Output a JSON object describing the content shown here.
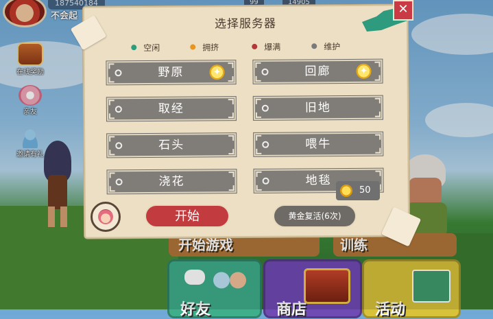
{
  "topbar": {
    "player_id": "187540184",
    "player_name": "不会起",
    "resource_1": "99",
    "resource_2": "14905"
  },
  "side_menu": {
    "items": [
      {
        "label": "在线奖励",
        "icon": "treasure-chest-icon"
      },
      {
        "label": "亲友",
        "icon": "flower-badge-icon"
      },
      {
        "label": "邀请有礼",
        "icon": "invite-friend-icon"
      }
    ]
  },
  "bottom_menu": {
    "start_game": "开始游戏",
    "training": "训练",
    "friends": "好友",
    "shop": "商店",
    "events": "活动"
  },
  "dialog": {
    "title": "选择服务器",
    "legend": [
      {
        "label": "空闲",
        "color": "#2e9b7b"
      },
      {
        "label": "拥挤",
        "color": "#e8951d"
      },
      {
        "label": "爆满",
        "color": "#b03a3a"
      },
      {
        "label": "维护",
        "color": "#7a7a7a"
      }
    ],
    "servers": [
      {
        "name": "野原",
        "starred": true
      },
      {
        "name": "回廊",
        "starred": true
      },
      {
        "name": "取经",
        "starred": false
      },
      {
        "name": "旧地",
        "starred": false
      },
      {
        "name": "石头",
        "starred": false
      },
      {
        "name": "喂牛",
        "starred": false
      },
      {
        "name": "浇花",
        "starred": false
      },
      {
        "name": "地毯",
        "starred": false
      }
    ],
    "coin_count": "50",
    "start_button": "开始",
    "revive_button": "黄金复活(6次)",
    "close_label": "✕"
  }
}
